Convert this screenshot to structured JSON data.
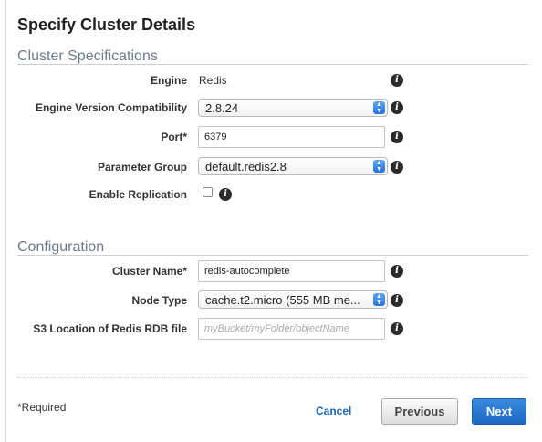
{
  "page": {
    "title": "Specify Cluster Details"
  },
  "cluster_specifications": {
    "heading": "Cluster Specifications",
    "engine": {
      "label": "Engine",
      "value": "Redis"
    },
    "engine_version": {
      "label": "Engine Version Compatibility",
      "selected": "2.8.24"
    },
    "port": {
      "label": "Port*",
      "value": "6379"
    },
    "parameter_group": {
      "label": "Parameter Group",
      "selected": "default.redis2.8"
    },
    "replication": {
      "label": "Enable Replication",
      "checked": false
    }
  },
  "configuration": {
    "heading": "Configuration",
    "cluster_name": {
      "label": "Cluster Name*",
      "value": "redis-autocomplete"
    },
    "node_type": {
      "label": "Node Type",
      "selected": "cache.t2.micro (555 MB me..."
    },
    "s3_location": {
      "label": "S3 Location of Redis RDB file",
      "placeholder": "myBucket/myFolder/objectName",
      "value": ""
    }
  },
  "footer": {
    "required_note": "*Required",
    "cancel_label": "Cancel",
    "previous_label": "Previous",
    "next_label": "Next"
  },
  "icons": {
    "info": "info-icon",
    "select_arrows": "up-down-arrows-icon"
  },
  "colors": {
    "primary_button": "#1d67c2",
    "link": "#1f67b5",
    "section_heading": "#6b7b8c"
  }
}
